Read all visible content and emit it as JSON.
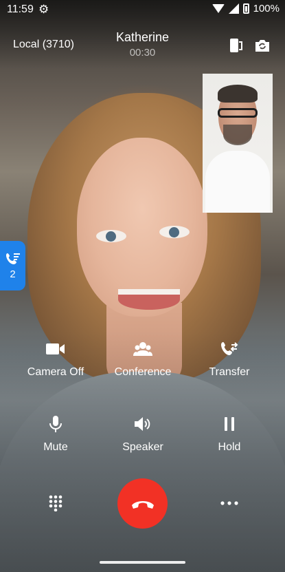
{
  "status_bar": {
    "time": "11:59",
    "battery": "100%",
    "icons": [
      "gear-icon",
      "wifi-icon",
      "signal-icon",
      "battery-charging-icon"
    ]
  },
  "call": {
    "line": "Local (3710)",
    "caller": "Katherine",
    "duration": "00:30"
  },
  "calls_tab": {
    "count": "2"
  },
  "controls": {
    "camera_off": "Camera Off",
    "conference": "Conference",
    "transfer": "Transfer",
    "mute": "Mute",
    "speaker": "Speaker",
    "hold": "Hold"
  },
  "colors": {
    "hangup": "#f23125",
    "calls_tab": "#1f82ea"
  }
}
